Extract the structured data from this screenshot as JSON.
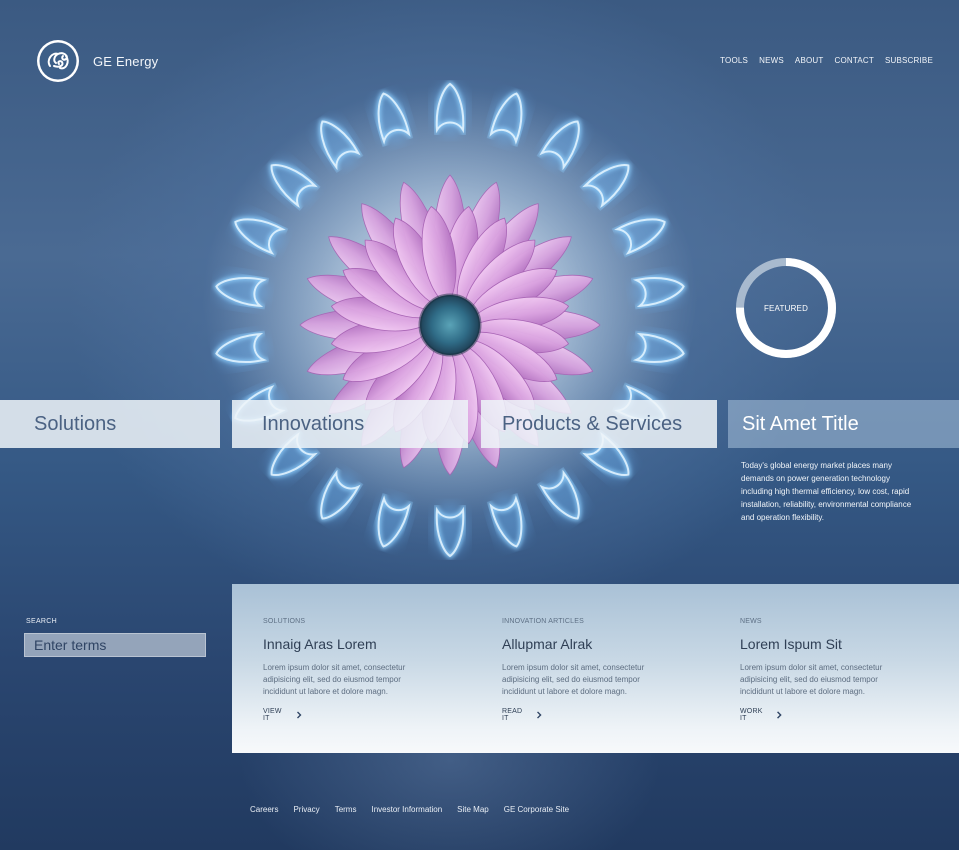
{
  "header": {
    "brand": "GE Energy",
    "logo_icon": "ge-monogram-icon",
    "nav": [
      "TOOLS",
      "NEWS",
      "ABOUT",
      "CONTACT",
      "SUBSCRIBE"
    ]
  },
  "hero": {
    "image": "flower-over-gas-flame",
    "featured_label": "FEATURED",
    "featured_progress": 0.75
  },
  "categories": [
    "Solutions",
    "Innovations",
    "Products & Services",
    "Sit Amet Title"
  ],
  "feature_text": "Today's global energy market places many demands on power generation technology including high thermal efficiency, low cost, rapid installation, reliability, environmental compliance and operation flexibility.",
  "search": {
    "label": "SEARCH",
    "placeholder": "Enter terms"
  },
  "columns": [
    {
      "category": "SOLUTIONS",
      "title": "Innaig Aras Lorem",
      "body": "Lorem ipsum dolor sit amet, consectetur adipisicing elit, sed do eiusmod tempor incididunt ut labore et dolore magn.",
      "link": "VIEW IT"
    },
    {
      "category": "INNOVATION ARTICLES",
      "title": "Allupmar Alrak",
      "body": "Lorem ipsum dolor sit amet, consectetur adipisicing elit, sed do eiusmod tempor incididunt ut labore et dolore magn.",
      "link": "READ IT"
    },
    {
      "category": "NEWS",
      "title": "Lorem Ispum Sit",
      "body": "Lorem ipsum dolor sit amet, consectetur adipisicing elit, sed do eiusmod tempor incididunt ut labore et dolore magn.",
      "link": "WORK IT"
    }
  ],
  "footer": [
    "Careers",
    "Privacy",
    "Terms",
    "Investor Information",
    "Site Map",
    "GE Corporate Site"
  ],
  "colors": {
    "background": "#2c4a72",
    "nav_box": "#eef3f8",
    "accent_text": "#4b6283",
    "flame": "#7fc4ff",
    "petal": "#d6a2e0"
  }
}
